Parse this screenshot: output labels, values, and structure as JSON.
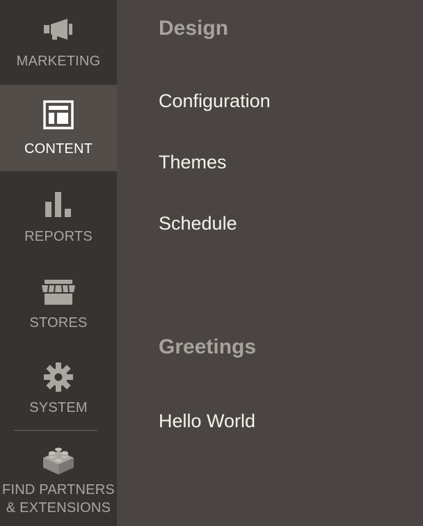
{
  "sidebar": {
    "items": [
      {
        "label": "MARKETING",
        "icon": "megaphone-icon"
      },
      {
        "label": "CONTENT",
        "icon": "layout-icon",
        "active": true
      },
      {
        "label": "REPORTS",
        "icon": "bar-chart-icon"
      },
      {
        "label": "STORES",
        "icon": "store-icon"
      },
      {
        "label": "SYSTEM",
        "icon": "gear-icon"
      },
      {
        "label_line1": "FIND PARTNERS",
        "label_line2": "& EXTENSIONS",
        "icon": "lego-brick-icon"
      }
    ]
  },
  "main": {
    "sections": [
      {
        "title": "Design",
        "links": [
          "Configuration",
          "Themes",
          "Schedule"
        ]
      },
      {
        "title": "Greetings",
        "links": [
          "Hello World"
        ]
      }
    ]
  },
  "colors": {
    "sidebar_bg": "#373330",
    "sidebar_active_bg": "#524d49",
    "main_bg": "#4a4542",
    "section_title": "#a8a29d",
    "link": "#f7f3eb",
    "nav_label": "#aaa6a0"
  }
}
